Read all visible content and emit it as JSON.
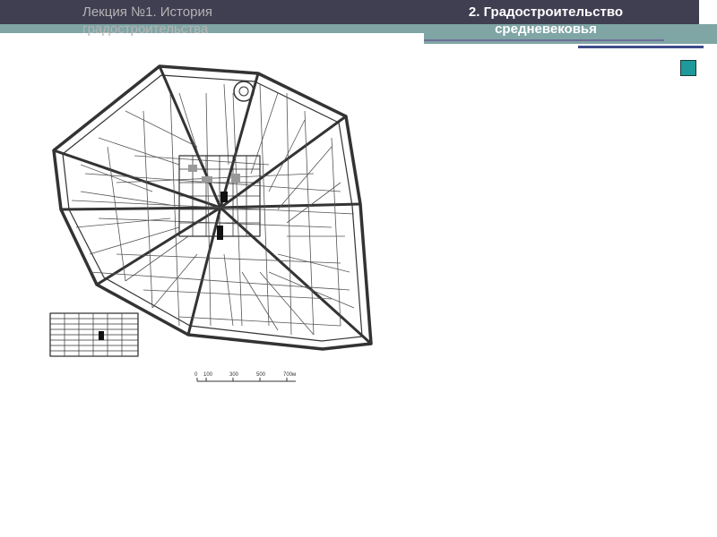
{
  "header": {
    "lecture_title": "Лекция №1. История градостроительства",
    "section_title": "2. Градостроительство средневековья"
  },
  "figure": {
    "scale_labels": [
      "0",
      "100",
      "300",
      "500",
      "700м"
    ]
  },
  "colors": {
    "header_dark": "#403e51",
    "header_teal": "#7fa5a5",
    "accent_square": "#1f9a9a"
  },
  "icons": [
    "slide-nav-square-icon"
  ]
}
